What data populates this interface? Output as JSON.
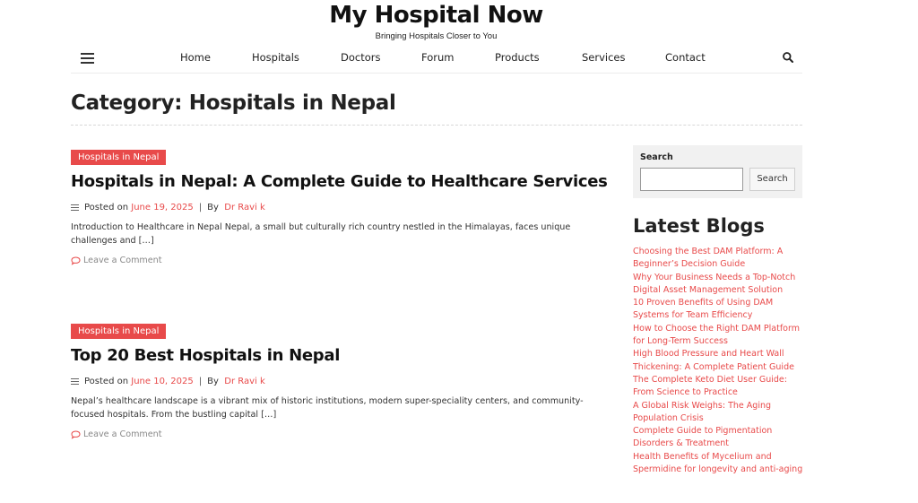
{
  "site": {
    "title": "My Hospital Now",
    "tagline": "Bringing Hospitals Closer to You"
  },
  "nav": {
    "items": [
      "Home",
      "Hospitals",
      "Doctors",
      "Forum",
      "Products",
      "Services",
      "Contact"
    ]
  },
  "page": {
    "title": "Category: Hospitals in Nepal"
  },
  "posts": [
    {
      "category": "Hospitals in Nepal",
      "title": "Hospitals in Nepal: A Complete Guide to Healthcare Services",
      "posted_on_label": "Posted on",
      "date": "June 19, 2025",
      "by_label": "By",
      "author": "Dr Ravi k",
      "excerpt": "Introduction to Healthcare in Nepal Nepal, a small but culturally rich country nestled in the Himalayas, faces unique challenges and […]",
      "comment_label": "Leave a Comment"
    },
    {
      "category": "Hospitals in Nepal",
      "title": "Top 20 Best Hospitals in Nepal",
      "posted_on_label": "Posted on",
      "date": "June 10, 2025",
      "by_label": "By",
      "author": "Dr Ravi k",
      "excerpt": "Nepal’s healthcare landscape is a vibrant mix of historic institutions, modern super-speciality centers, and community-focused hospitals. From the bustling capital […]",
      "comment_label": "Leave a Comment"
    }
  ],
  "sidebar": {
    "search_label": "Search",
    "search_placeholder": "",
    "search_button": "Search",
    "latest_title": "Latest Blogs",
    "latest": [
      "Choosing the Best DAM Platform: A Beginner’s Decision Guide",
      "Why Your Business Needs a Top-Notch Digital Asset Management Solution",
      "10 Proven Benefits of Using DAM Systems for Team Efficiency",
      "How to Choose the Right DAM Platform for Long-Term Success",
      "High Blood Pressure and Heart Wall Thickening: A Complete Patient Guide",
      "The Complete Keto Diet User Guide: From Science to Practice",
      "A Global Risk Weighs: The Aging Population Crisis",
      "Complete Guide to Pigmentation Disorders & Treatment",
      "Health Benefits of Mycelium and Spermidine for longevity and anti-aging"
    ]
  },
  "colors": {
    "accent": "#e84a4a",
    "text": "#222222",
    "muted": "#888888"
  },
  "icons": {
    "menu": "hamburger-icon",
    "search": "search-icon",
    "meta": "list-lines-icon",
    "comment": "comment-bubble-icon"
  }
}
